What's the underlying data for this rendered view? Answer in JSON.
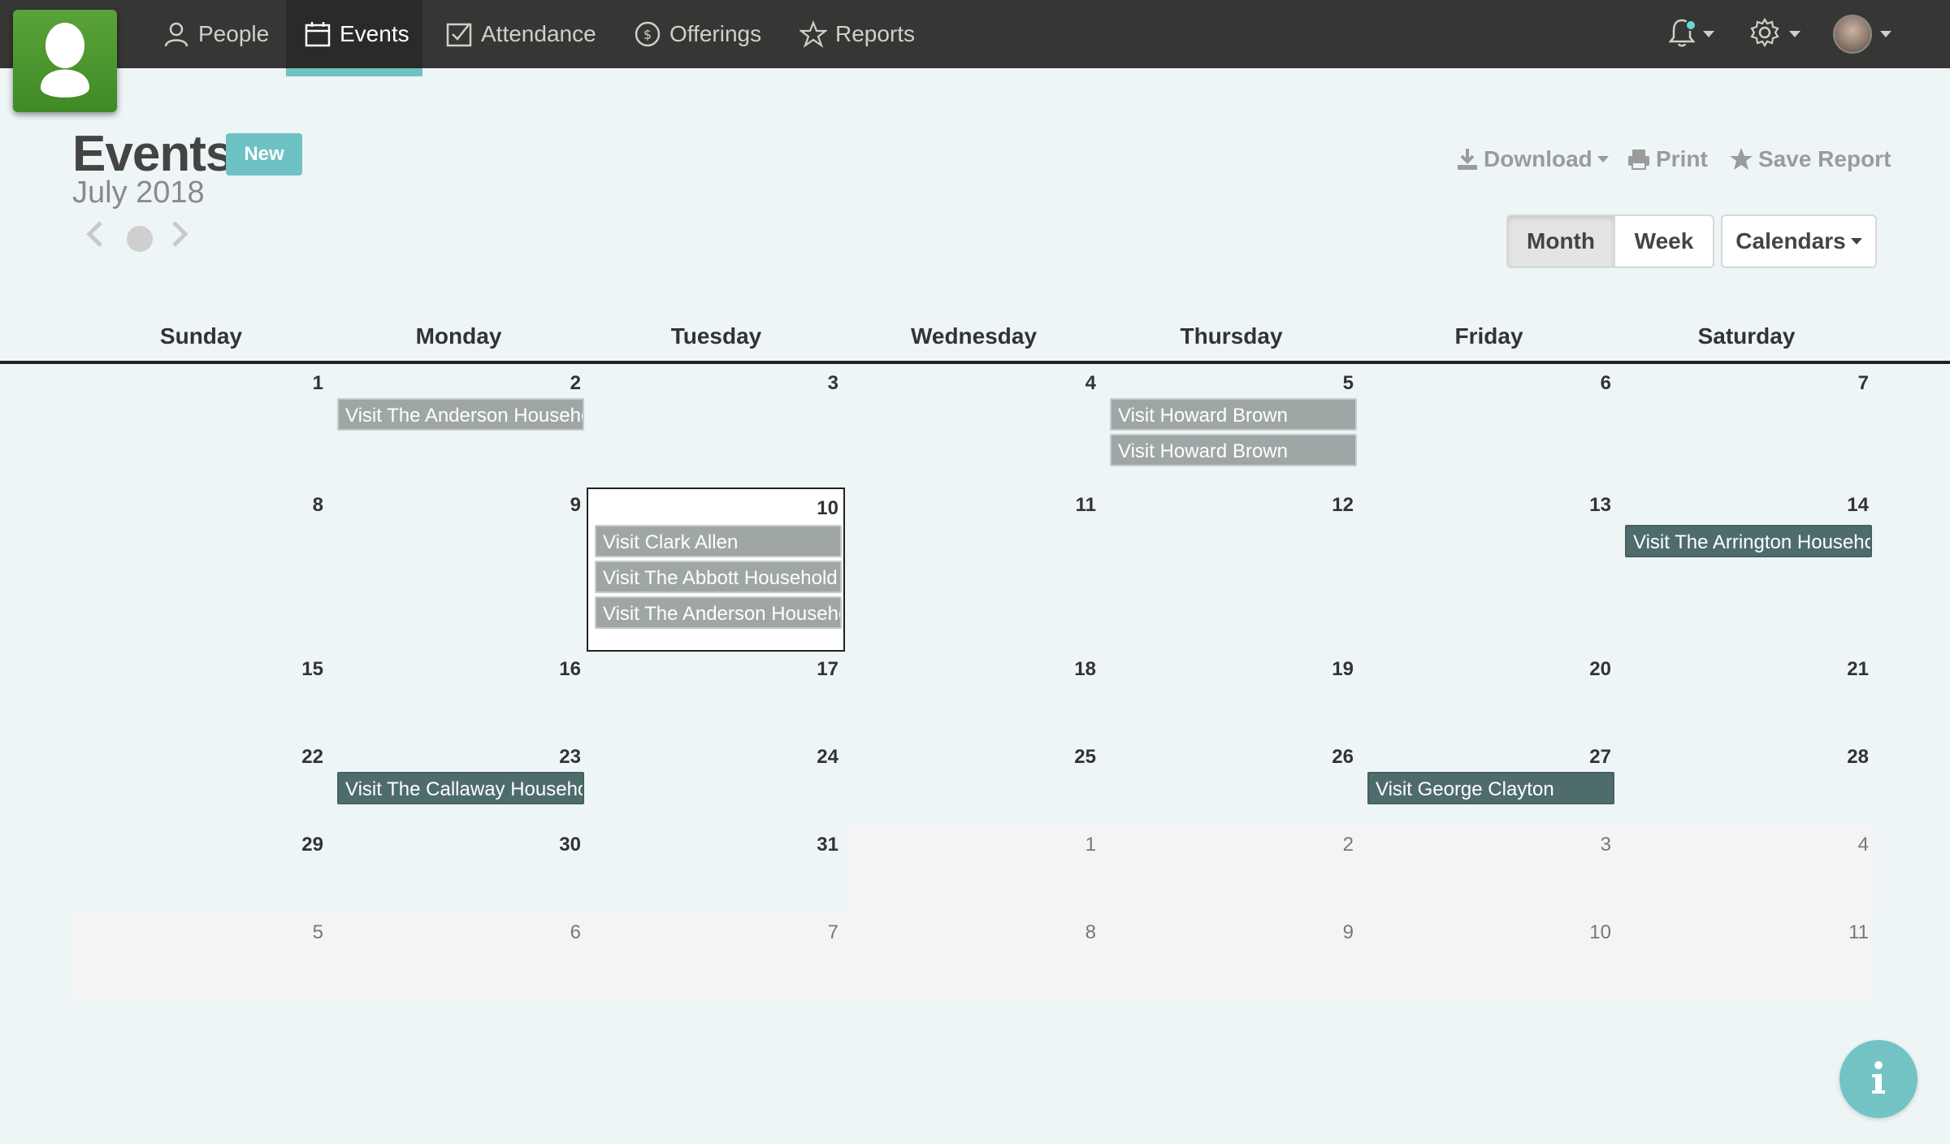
{
  "nav": {
    "items": [
      {
        "label": "People",
        "icon": "person-icon",
        "active": false
      },
      {
        "label": "Events",
        "icon": "calendar-icon",
        "active": true
      },
      {
        "label": "Attendance",
        "icon": "checkbox-icon",
        "active": false
      },
      {
        "label": "Offerings",
        "icon": "dollar-circle-icon",
        "active": false
      },
      {
        "label": "Reports",
        "icon": "star-icon",
        "active": false
      }
    ],
    "right": [
      "bell-icon",
      "gear-icon",
      "avatar"
    ]
  },
  "header": {
    "title": "Events",
    "new_label": "New",
    "month_label": "July 2018",
    "actions": {
      "download": "Download",
      "print": "Print",
      "save_report": "Save Report"
    },
    "views": {
      "month": "Month",
      "week": "Week",
      "calendars": "Calendars"
    },
    "active_view": "Month"
  },
  "calendar": {
    "days_of_week": [
      "Sunday",
      "Monday",
      "Tuesday",
      "Wednesday",
      "Thursday",
      "Friday",
      "Saturday"
    ],
    "weeks": [
      [
        "1",
        "2",
        "3",
        "4",
        "5",
        "6",
        "7"
      ],
      [
        "8",
        "9",
        "10",
        "11",
        "12",
        "13",
        "14"
      ],
      [
        "15",
        "16",
        "17",
        "18",
        "19",
        "20",
        "21"
      ],
      [
        "22",
        "23",
        "24",
        "25",
        "26",
        "27",
        "28"
      ],
      [
        "29",
        "30",
        "31",
        "1",
        "2",
        "3",
        "4"
      ],
      [
        "5",
        "6",
        "7",
        "8",
        "9",
        "10",
        "11"
      ]
    ],
    "today": "10",
    "events": [
      {
        "label": "Visit The Anderson Household",
        "date": "2018-07-02",
        "style": "grey"
      },
      {
        "label": "Visit Howard Brown",
        "date": "2018-07-05",
        "style": "grey"
      },
      {
        "label": "Visit Howard Brown",
        "date": "2018-07-05",
        "style": "grey"
      },
      {
        "label": "Visit Clark Allen",
        "date": "2018-07-10",
        "style": "grey"
      },
      {
        "label": "Visit The Abbott Household",
        "date": "2018-07-10",
        "style": "grey"
      },
      {
        "label": "Visit The Anderson Household",
        "date": "2018-07-10",
        "style": "grey"
      },
      {
        "label": "Visit The Arrington Household",
        "date": "2018-07-14",
        "style": "dark"
      },
      {
        "label": "Visit The Callaway Household",
        "date": "2018-07-23",
        "style": "dark"
      },
      {
        "label": "Visit George Clayton",
        "date": "2018-07-27",
        "style": "dark"
      }
    ]
  },
  "colors": {
    "nav_bg": "#363634",
    "accent": "#6fc2c4",
    "event_grey": "#9fa7a6",
    "event_dark": "#4f6c6d",
    "page_bg": "#eef5f6"
  }
}
